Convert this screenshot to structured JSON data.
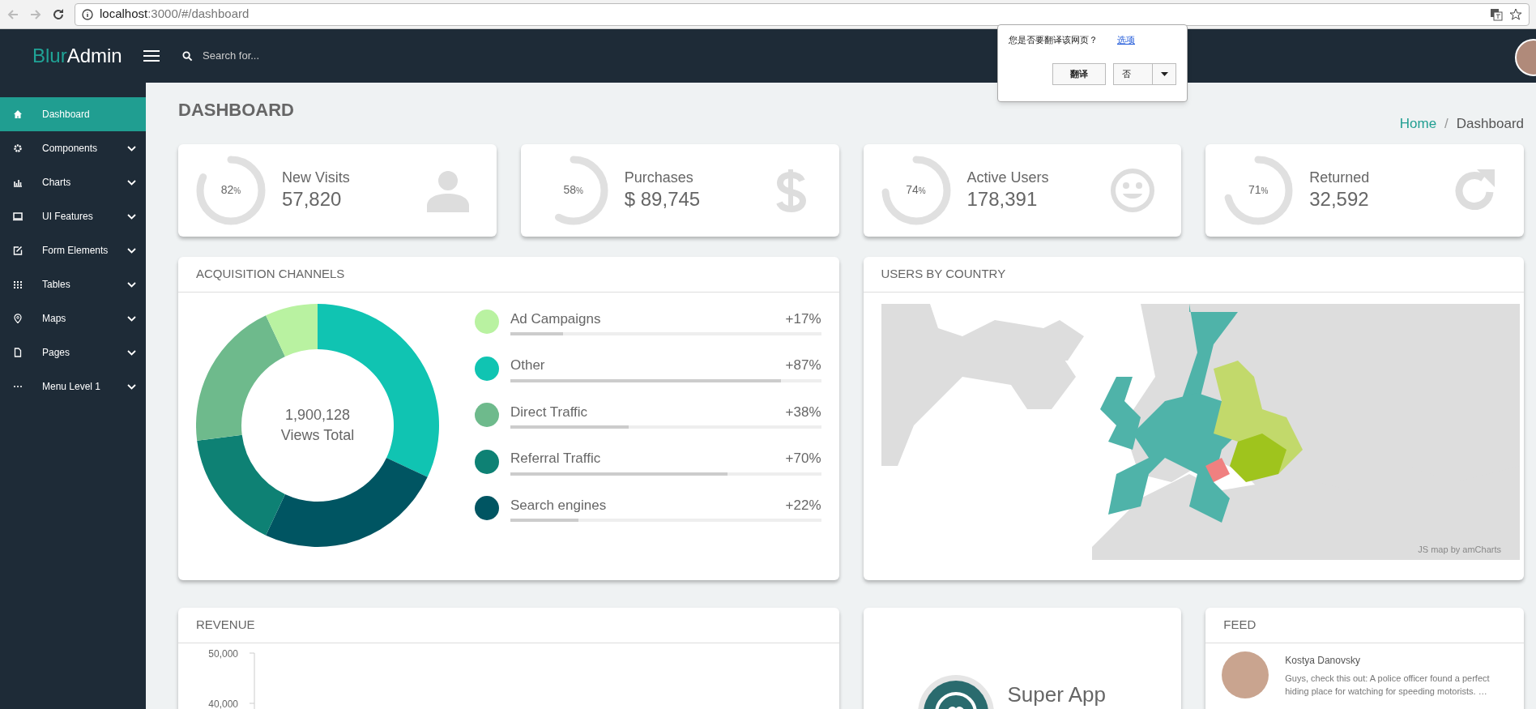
{
  "browser": {
    "url_host": "localhost",
    "url_rest": ":3000/#/dashboard"
  },
  "header": {
    "logo_first": "Blur",
    "logo_second": "Admin",
    "search": {
      "placeholder": "Search for..."
    }
  },
  "translate_popup": {
    "question": "您是否要翻译该网页？",
    "options_link": "选项",
    "translate_button": "翻译",
    "no_button": "否"
  },
  "sidebar": {
    "items": [
      {
        "label": "Dashboard",
        "selected": true,
        "expandable": false
      },
      {
        "label": "Components",
        "selected": false,
        "expandable": true
      },
      {
        "label": "Charts",
        "selected": false,
        "expandable": true
      },
      {
        "label": "UI Features",
        "selected": false,
        "expandable": true
      },
      {
        "label": "Form Elements",
        "selected": false,
        "expandable": true
      },
      {
        "label": "Tables",
        "selected": false,
        "expandable": true
      },
      {
        "label": "Maps",
        "selected": false,
        "expandable": true
      },
      {
        "label": "Pages",
        "selected": false,
        "expandable": true
      },
      {
        "label": "Menu Level 1",
        "selected": false,
        "expandable": true
      }
    ]
  },
  "page_title": "DASHBOARD",
  "breadcrumb": [
    {
      "label": "Home",
      "kind": "link"
    },
    {
      "label": "/",
      "kind": "separator"
    },
    {
      "label": "Dashboard",
      "kind": "current"
    }
  ],
  "stats": [
    {
      "percent": "82",
      "unit": "%",
      "level": 0.82,
      "label": "New Visits",
      "value": "57,820"
    },
    {
      "percent": "58",
      "unit": "%",
      "level": 0.58,
      "label": "Purchases",
      "value": "$ 89,745"
    },
    {
      "percent": "74",
      "unit": "%",
      "level": 0.74,
      "label": "Active Users",
      "value": "178,391"
    },
    {
      "percent": "71",
      "unit": "%",
      "level": 0.71,
      "label": "Returned",
      "value": "32,592"
    }
  ],
  "acquisition": {
    "title": "ACQUISITION CHANNELS",
    "total": "1,900,128",
    "total_label": "Views Total",
    "channels": [
      {
        "name": "Ad Campaigns",
        "change": "+17%",
        "level": 0.17,
        "color": "#b9f2a1"
      },
      {
        "name": "Other",
        "change": "+87%",
        "level": 0.87,
        "color": "#10c4b2"
      },
      {
        "name": "Direct Traffic",
        "change": "+38%",
        "level": 0.38,
        "color": "#6eba8c"
      },
      {
        "name": "Referral Traffic",
        "change": "+70%",
        "level": 0.7,
        "color": "#0e8174"
      },
      {
        "name": "Search engines",
        "change": "+22%",
        "level": 0.22,
        "color": "#005562"
      }
    ]
  },
  "users_by_country": {
    "title": "USERS BY COUNTRY",
    "credit": "JS map by amCharts"
  },
  "revenue": {
    "title": "REVENUE",
    "y_ticks": [
      "50,000",
      "40,000"
    ]
  },
  "app_card": {
    "name": "Super App"
  },
  "feed": {
    "title": "FEED",
    "items": [
      {
        "author": "Kostya Danovsky",
        "text": "Guys, check this out: A police officer found a perfect hiding place for watching for speeding motorists. …"
      }
    ]
  }
}
